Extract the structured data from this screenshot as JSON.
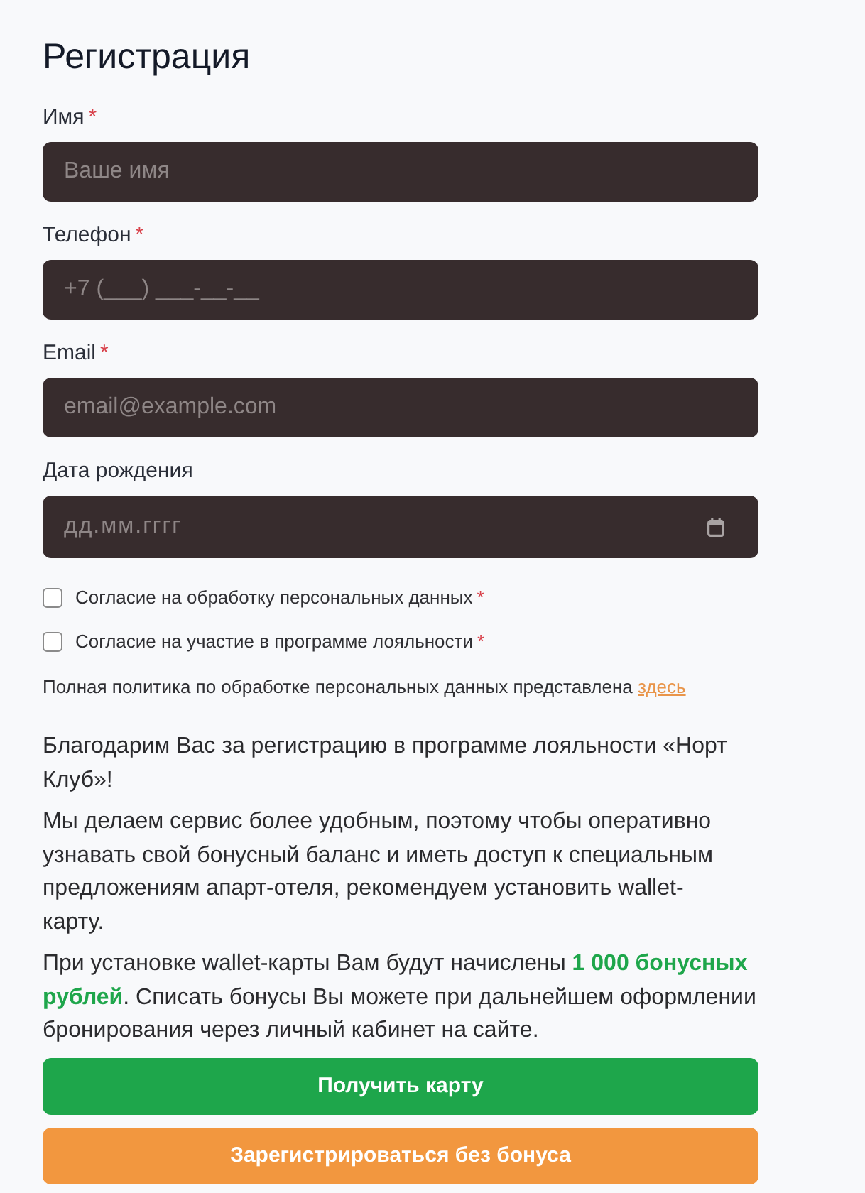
{
  "title": "Регистрация",
  "fields": [
    {
      "kind": "text",
      "label": "Имя",
      "mark": "*",
      "placeholder": "Ваше имя"
    },
    {
      "kind": "text",
      "label": "Телефон",
      "mark": "*",
      "placeholder": "+7 (___) ___-__-__"
    },
    {
      "kind": "text",
      "label": "Email",
      "mark": "*",
      "placeholder": "email@example.com"
    },
    {
      "kind": "date",
      "label": "Дата рождения",
      "placeholder": "дд.мм.гггг"
    }
  ],
  "consents": [
    {
      "label": "Согласие на обработку персональных данных",
      "mark": "*",
      "checked": false
    },
    {
      "label": "Согласие на участие в программе лояльности",
      "mark": "*",
      "checked": false
    }
  ],
  "policy": {
    "text": "Полная политика по обработке персональных данных представлена",
    "link": "здесь"
  },
  "paragraphs": [
    "Благодарим Вас за регистрацию в программе лояльности «Норт Клуб»!",
    "Мы делаем сервис более удобным, поэтому чтобы оперативно узнавать свой бонусный баланс и иметь доступ к специальным предложениям апарт-отеля, рекомендуем установить wallet-карту.",
    "При установке wallet-карты Вам будут начислены **1 000 бонусных рублей**. Списать бонусы Вы можете при дальнейшем оформлении бронирования через личный кабинет на сайте."
  ],
  "buttons": [
    {
      "kind": "primary",
      "label": "Получить карту"
    },
    {
      "kind": "secondary",
      "label": "Зарегистрироваться без бонуса"
    }
  ]
}
